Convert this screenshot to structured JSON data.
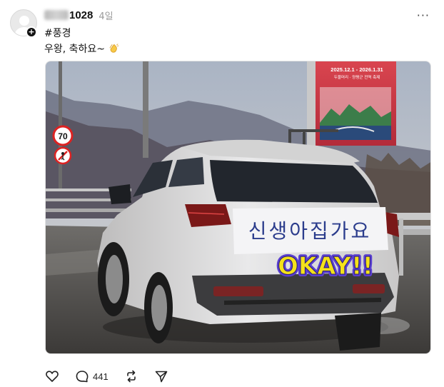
{
  "post": {
    "username_visible": "1028",
    "timestamp": "4일",
    "more_label": "···",
    "follow_badge": "+",
    "hashtag": "#풍경",
    "caption": "우왕, 축하요~",
    "caption_emoji_icon": "clapping-hands-icon"
  },
  "photo": {
    "speed_sign": "70",
    "billboard_line1": "2025.12.1 - 2026.1.31",
    "billboard_line2": "두물머리 · 양평군 전역 축제",
    "rear_window_sign": "신생아집가요",
    "sticker_text": "OKAY!!",
    "sticker_color": "#f4e11a",
    "sticker_outline": "#5a3fd0"
  },
  "actions": {
    "like_icon": "heart-icon",
    "comment_icon": "comment-icon",
    "comment_count": "441",
    "repost_icon": "repost-icon",
    "share_icon": "send-icon"
  }
}
